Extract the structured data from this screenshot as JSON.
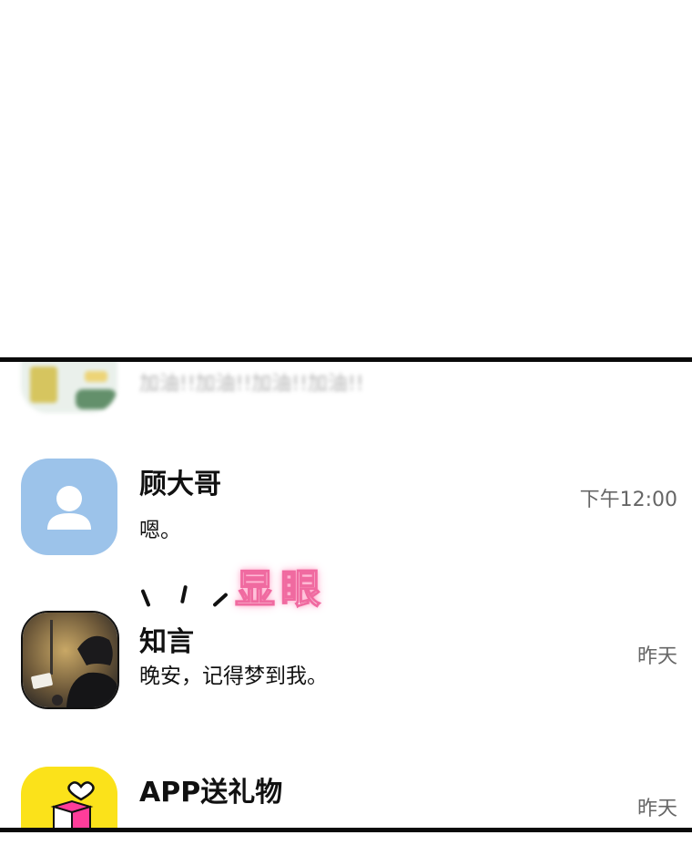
{
  "chats": [
    {
      "name": "",
      "message": "加油!!加油!!加油!!加油!!",
      "time": ""
    },
    {
      "name": "顾大哥",
      "message": "嗯。",
      "time": "下午12:00"
    },
    {
      "name": "知言",
      "message": "晚安，记得梦到我。",
      "time": "昨天"
    },
    {
      "name": "APP送礼物",
      "message": "",
      "time": "昨天"
    }
  ],
  "annotation": {
    "text": "显眼"
  },
  "icons": {
    "default_avatar": "person-silhouette-icon",
    "gift_avatar": "gift-box-heart-icon"
  },
  "colors": {
    "default_avatar_bg": "#9cc3ea",
    "gift_avatar_bg": "#fbe21a",
    "annotation_glow": "#f06aa0",
    "frame": "#0a0a0a"
  }
}
